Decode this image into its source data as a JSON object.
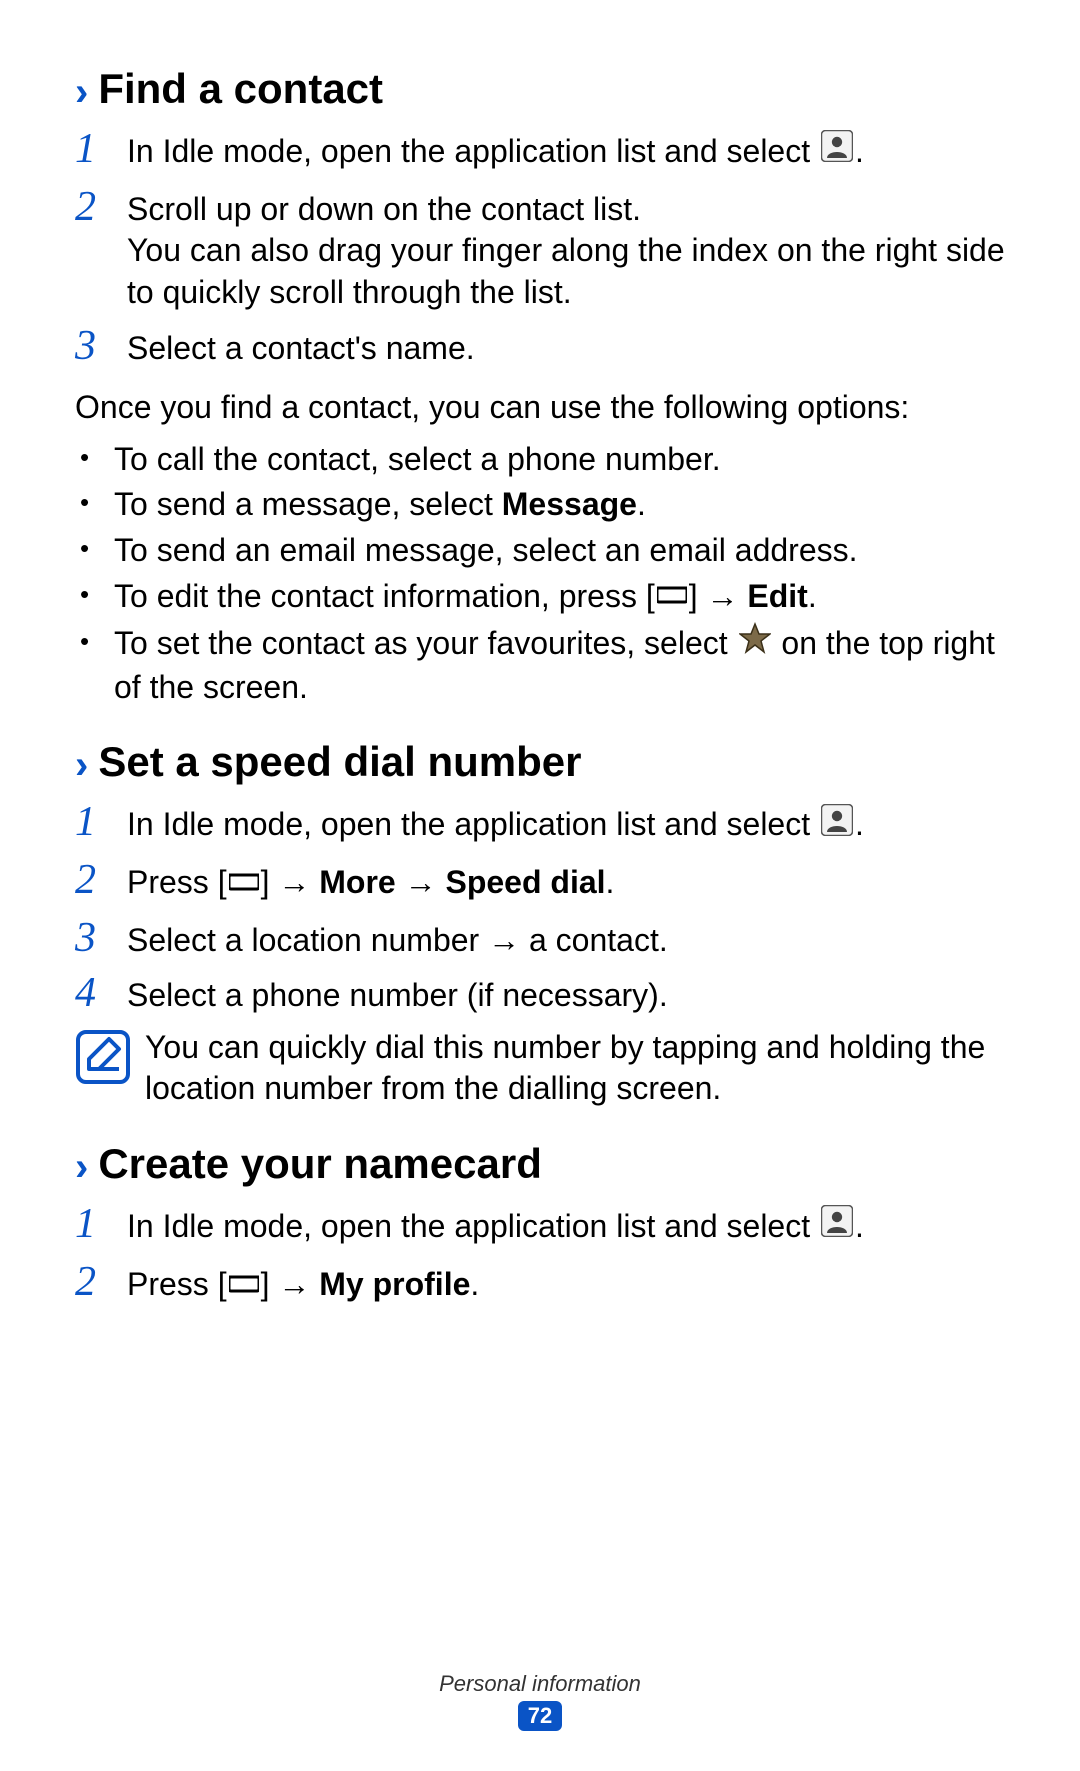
{
  "section1": {
    "title": "Find a contact",
    "steps": {
      "s1": {
        "num": "1",
        "text": "In Idle mode, open the application list and select ",
        "after": "."
      },
      "s2": {
        "num": "2",
        "line1": "Scroll up or down on the contact list.",
        "line2a": "You can also drag your finger along the index on the right side to quickly scroll through the list."
      },
      "s3": {
        "num": "3",
        "text": "Select a contact's name."
      }
    },
    "para": "Once you find a contact, you can use the following options:",
    "bullets": {
      "b1": "To call the contact, select a phone number.",
      "b2_a": "To send a message, select ",
      "b2_bold": "Message",
      "b2_b": ".",
      "b3": "To send an email message, select an email address.",
      "b4_a": "To edit the contact information, press [",
      "b4_b": "] → ",
      "b4_bold": "Edit",
      "b4_c": ".",
      "b5_a": "To set the contact as your favourites, select ",
      "b5_b": " on the top right of the screen."
    }
  },
  "section2": {
    "title": "Set a speed dial number",
    "steps": {
      "s1": {
        "num": "1",
        "text": "In Idle mode, open the application list and select ",
        "after": "."
      },
      "s2": {
        "num": "2",
        "a": "Press [",
        "b": "] → ",
        "bold1": "More",
        "c": " → ",
        "bold2": "Speed dial",
        "d": "."
      },
      "s3": {
        "num": "3",
        "text": "Select a location number → a contact."
      },
      "s4": {
        "num": "4",
        "text": "Select a phone number (if necessary)."
      }
    },
    "note": "You can quickly dial this number by tapping and holding the location number from the dialling screen."
  },
  "section3": {
    "title": "Create your namecard",
    "steps": {
      "s1": {
        "num": "1",
        "text": "In Idle mode, open the application list and select ",
        "after": "."
      },
      "s2": {
        "num": "2",
        "a": "Press [",
        "b": "] → ",
        "bold": "My profile",
        "c": "."
      }
    }
  },
  "footer": {
    "label": "Personal information",
    "page": "72"
  },
  "icons": {
    "contacts": "contacts-icon",
    "menu": "menu-icon",
    "star": "star-icon",
    "note": "note-icon"
  }
}
